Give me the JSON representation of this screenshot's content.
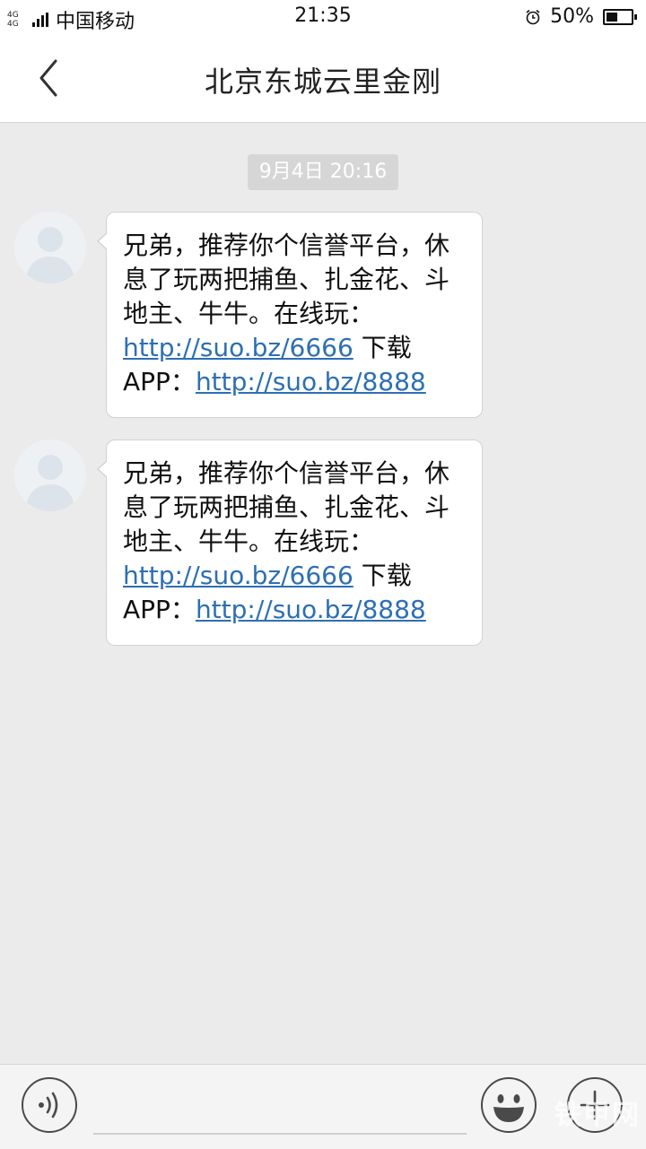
{
  "status_bar": {
    "network": "4G 4G",
    "carrier": "中国移动",
    "time": "21:35",
    "battery_percent": "50%"
  },
  "header": {
    "title": "北京东城云里金刚"
  },
  "conversation": {
    "date_chip": "9月4日 20:16",
    "messages": [
      {
        "text_1": "兄弟，推荐你个信誉平台，休息了玩两把捕鱼、扎金花、斗地主、牛牛。在线玩：",
        "link_1": "http://suo.bz/6666",
        "text_2": " 下载APP：",
        "link_2": "http://suo.bz/8888"
      },
      {
        "text_1": "兄弟，推荐你个信誉平台，休息了玩两把捕鱼、扎金花、斗地主、牛牛。在线玩：",
        "link_1": "http://suo.bz/6666",
        "text_2": " 下载APP：",
        "link_2": "http://suo.bz/8888"
      }
    ]
  },
  "watermark": "铁甲网",
  "icons": {
    "back": "chevron-left-icon",
    "avatar": "person-avatar-icon",
    "voice": "voice-input-icon",
    "emoji": "emoji-icon",
    "plus": "plus-icon",
    "alarm": "alarm-clock-icon"
  },
  "colors": {
    "link": "#2d6fb3",
    "background": "#ebebeb",
    "date_chip": "#d6d6d6"
  }
}
